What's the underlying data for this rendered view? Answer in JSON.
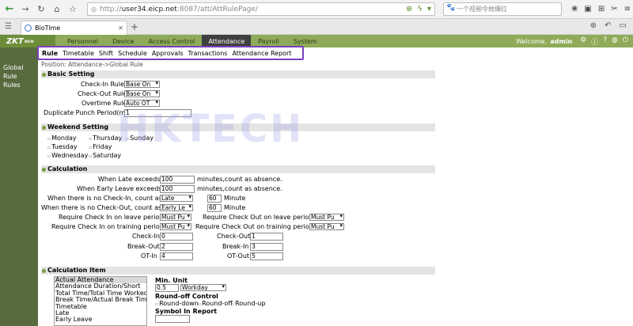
{
  "browser": {
    "url_host": "user34.eicp.net",
    "url_prefix": "http://",
    "url_rest": ":8087/att/AttRulePage/",
    "search_placeholder": "一个视频令她爆红",
    "tab_title": "BioTime",
    "tab_close": "✕",
    "new_tab": "+"
  },
  "app": {
    "logo": "ZKT",
    "logo_suffix": "eco",
    "nav": [
      "Personnel",
      "Device",
      "Access Control",
      "Attendance",
      "Payroll",
      "System"
    ],
    "active_nav": "Attendance",
    "welcome": "Welcome,",
    "user": "admin"
  },
  "subnav": [
    "Rule",
    "Timetable",
    "Shift",
    "Schedule",
    "Approvals",
    "Transactions",
    "Attendance Report"
  ],
  "left_panel": [
    "Global Rule",
    "Rules"
  ],
  "position": "Position: Attendance->Global Rule",
  "basic_setting": {
    "title": "Basic Setting",
    "checkin_rule_label": "Check-In Rule",
    "checkin_rule_value": "Base On",
    "checkout_rule_label": "Check-Out Rule",
    "checkout_rule_value": "Base On",
    "overtime_rule_label": "Overtime Rule",
    "overtime_rule_value": "Auto OT",
    "dup_period_label": "Duplicate Punch Period(m)",
    "dup_period_value": "1"
  },
  "weekend_setting": {
    "title": "Weekend Setting",
    "days": [
      "Monday",
      "Thursday",
      "Sunday",
      "Tuesday",
      "Friday",
      "Wednesday",
      "Saturday"
    ]
  },
  "calculation": {
    "title": "Calculation",
    "late_label": "When Late exceeds",
    "late_value": "100",
    "late_suffix": "minutes,count as absence.",
    "early_label": "When Early Leave exceeds",
    "early_value": "100",
    "early_suffix": "minutes,count as absence.",
    "no_checkin_label": "When there is no Check-In, count as",
    "no_checkin_select": "Late",
    "no_checkin_minutes": "60",
    "no_checkout_label": "When there is no Check-Out, count as",
    "no_checkout_select": "Early Le",
    "no_checkout_minutes": "60",
    "minute": "Minute",
    "req_in_leave_label": "Require Check In on leave period",
    "req_in_leave_value": "Must Pu",
    "req_out_leave_label": "Require Check Out on leave period",
    "req_out_leave_value": "Must Pu",
    "req_in_training_label": "Require Check In on training period",
    "req_in_training_value": "Must Pu",
    "req_out_training_label": "Require Check Out on training period",
    "req_out_training_value": "Must Pu",
    "checkin_label": "Check-In",
    "checkin_value": "0",
    "checkout_label": "Check-Out",
    "checkout_value": "1",
    "breakout_label": "Break-Out",
    "breakout_value": "2",
    "breakin_label": "Break-In",
    "breakin_value": "3",
    "otin_label": "OT-In",
    "otin_value": "4",
    "otout_label": "OT-Out",
    "otout_value": "5"
  },
  "calc_item": {
    "title": "Calculation Item",
    "items": [
      "Actual Attendance",
      "Attendance Duration/Short",
      "Total Time/Total Time Worked",
      "Break Time/Actual Break Time",
      "Timetable",
      "Late",
      "Early Leave"
    ],
    "min_unit_label": "Min. Unit",
    "min_unit_value": "0.5",
    "min_unit_select": "Workday",
    "roundoff_label": "Round-off Control",
    "round_options": [
      "Round-down",
      "Round-off",
      "Round-up"
    ],
    "symbol_label": "Symbol In Report"
  },
  "watermark": "HKTECH",
  "colors": {
    "header_green": "#8dab58",
    "left_panel": "#586b3f",
    "highlight_box": "#7b3fbf"
  }
}
